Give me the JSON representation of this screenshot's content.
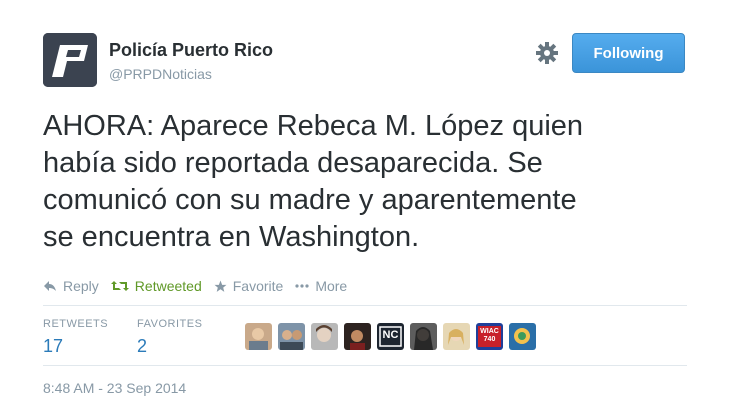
{
  "account": {
    "name": "Policía Puerto Rico",
    "handle": "@PRPDNoticias",
    "follow_label": "Following"
  },
  "tweet": {
    "lines": [
      "AHORA: Aparece Rebeca M. López quien",
      "había sido reportada desaparecida. Se",
      "comunicó con su madre y aparentemente",
      "se encuentra en Washington."
    ]
  },
  "actions": {
    "reply": "Reply",
    "retweet": "Retweeted",
    "favorite": "Favorite",
    "more": "More"
  },
  "stats": {
    "retweets_label": "RETWEETS",
    "retweets_count": "17",
    "favorites_label": "FAVORITES",
    "favorites_count": "2"
  },
  "avatars": [
    {
      "icon": "user-avatar"
    },
    {
      "icon": "user-avatar"
    },
    {
      "icon": "user-avatar"
    },
    {
      "icon": "user-avatar"
    },
    {
      "icon": "nc-logo-avatar",
      "text": "NC"
    },
    {
      "icon": "user-avatar"
    },
    {
      "icon": "user-avatar"
    },
    {
      "icon": "wiac-logo-avatar",
      "text": "WIAC 740"
    },
    {
      "icon": "user-avatar"
    }
  ],
  "timestamp": "8:48 AM - 23 Sep 2014",
  "colors": {
    "link_blue": "#2b7bb9",
    "follow_button": "#55acee",
    "retweeted_green": "#609928",
    "muted": "#8899a6"
  }
}
